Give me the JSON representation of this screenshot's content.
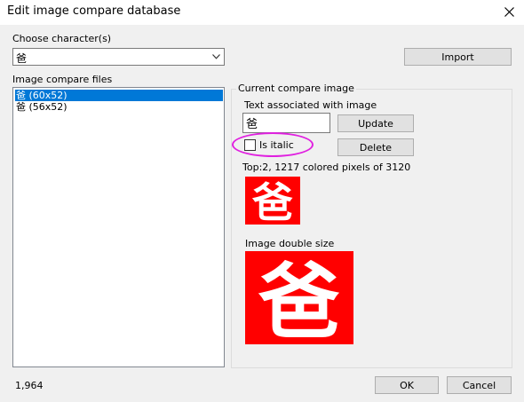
{
  "window": {
    "title": "Edit image compare database"
  },
  "choose_character": {
    "label": "Choose character(s)",
    "selected_value": "爸"
  },
  "import_button": "Import",
  "files": {
    "label": "Image compare files",
    "items": [
      {
        "label": "爸 (60x52)",
        "selected": true
      },
      {
        "label": "爸 (56x52)",
        "selected": false
      }
    ]
  },
  "current_image": {
    "group_label": "Current compare image",
    "text_label": "Text associated with image",
    "text_value": "爸",
    "update_button": "Update",
    "delete_button": "Delete",
    "italic_label": "Is italic",
    "italic_checked": false,
    "stats": "Top:2, 1217 colored pixels of 3120",
    "double_size_label": "Image double size",
    "glyph": "爸",
    "image_background_color": "#ff0000",
    "glyph_color": "#ffffff"
  },
  "annotation": {
    "highlight_color": "#e020e0"
  },
  "footer": {
    "count": "1,964",
    "ok_button": "OK",
    "cancel_button": "Cancel"
  }
}
